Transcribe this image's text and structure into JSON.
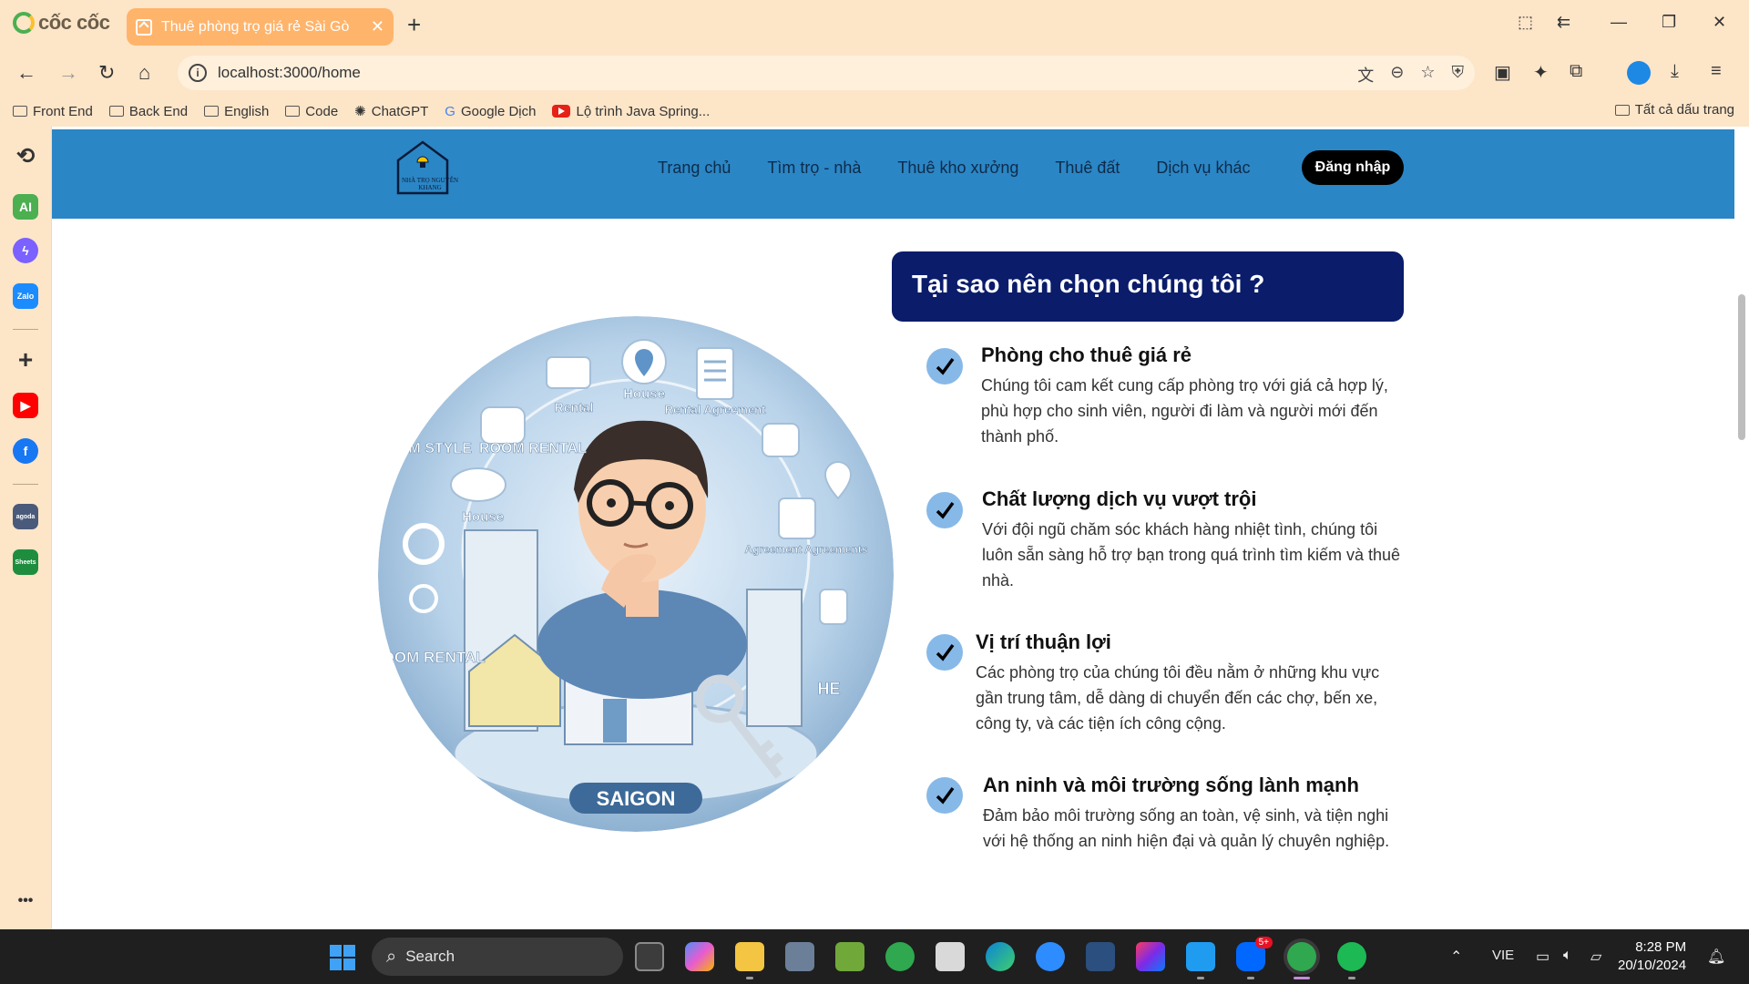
{
  "browser": {
    "brand": "cốc cốc",
    "tab_title": "Thuê phòng trọ giá rẻ Sài Gò",
    "url": "localhost:3000/home",
    "bookmarks": [
      "Front End",
      "Back End",
      "English",
      "Code",
      "ChatGPT",
      "Google Dịch",
      "Lộ trình Java Spring..."
    ],
    "bookmarks_all": "Tất cả dấu trang"
  },
  "site": {
    "logo_text": "NHÀ TRỌ NGUYỄN KHANG",
    "menu": [
      "Trang chủ",
      "Tìm trọ - nhà",
      "Thuê kho xưởng",
      "Thuê đất",
      "Dịch vụ khác"
    ],
    "login": "Đăng nhập",
    "why_title": "Tại sao nên chọn chúng tôi ?",
    "hero": {
      "labels": [
        "House",
        "Rental",
        "Rental Agreement",
        "ROOM STYLE",
        "ROOM RENTAL",
        "House",
        "Agreement Agreements",
        "ROOM RENTAL",
        "HE",
        "SAIGON"
      ]
    },
    "features": [
      {
        "title": "Phòng cho thuê giá rẻ",
        "desc": "Chúng tôi cam kết cung cấp phòng trọ với giá cả hợp lý, phù hợp cho sinh viên, người đi làm và người mới đến thành phố."
      },
      {
        "title": "Chất lượng dịch vụ vượt trội",
        "desc": "Với đội ngũ chăm sóc khách hàng nhiệt tình, chúng tôi luôn sẵn sàng hỗ trợ bạn trong quá trình tìm kiếm và thuê nhà."
      },
      {
        "title": "Vị trí thuận lợi",
        "desc": "Các phòng trọ của chúng tôi đều nằm ở những khu vực gần trung tâm, dễ dàng di chuyển đến các chợ, bến xe, công ty, và các tiện ích công cộng."
      },
      {
        "title": "An ninh và môi trường sống lành mạnh",
        "desc": "Đảm bảo môi trường sống an toàn, vệ sinh, và tiện nghi với hệ thống an ninh hiện đại và quản lý chuyên nghiệp."
      }
    ]
  },
  "sidebar": {
    "ai_label": "AI",
    "zalo_label": "Zalo",
    "agoda_label": "agoda",
    "sheets_label": "Sheets",
    "more": "•••"
  },
  "taskbar": {
    "search": "Search",
    "zalo_badge": "5+",
    "language": "VIE",
    "time": "8:28 PM",
    "date": "20/10/2024"
  },
  "colors": {
    "chrome_bg": "#fde5c8",
    "tab_active": "#ffb46b",
    "header_blue": "#2b86c5",
    "why_box": "#0a1c6a",
    "check_circle": "#86b9e8"
  }
}
